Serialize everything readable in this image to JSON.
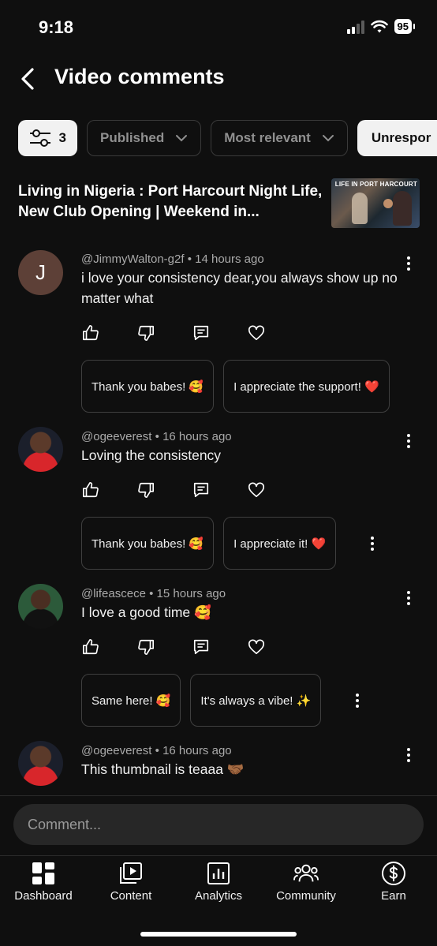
{
  "status": {
    "time": "9:18",
    "battery": "95"
  },
  "header": {
    "title": "Video comments"
  },
  "filters": {
    "filter_count": "3",
    "published": "Published",
    "sort": "Most relevant",
    "unresponded": "Unrespor"
  },
  "video": {
    "title": "Living in Nigeria : Port Harcourt Night Life, New Club Opening | Weekend in...",
    "thumb_text": "LIFE IN PORT HARCOURT"
  },
  "comments": [
    {
      "avatar_letter": "J",
      "author": "@JimmyWalton-g2f",
      "time": "14 hours ago",
      "text": "i love your consistency dear,you always show up no matter what",
      "replies": [
        "Thank you babes! 🥰",
        "I appreciate the support! ❤️"
      ]
    },
    {
      "author": "@ogeeverest",
      "time": "16 hours ago",
      "text": "Loving the consistency",
      "replies": [
        "Thank you babes! 🥰",
        "I appreciate it! ❤️"
      ]
    },
    {
      "author": "@lifeascece",
      "time": "15 hours ago",
      "text": "I love a good time 🥰",
      "replies": [
        "Same here! 🥰",
        "It's always a vibe! ✨"
      ]
    },
    {
      "author": "@ogeeverest",
      "time": "16 hours ago",
      "text": "This thumbnail is teaaa 🤝🏾"
    }
  ],
  "composer": {
    "placeholder": "Comment..."
  },
  "nav": {
    "dashboard": "Dashboard",
    "content": "Content",
    "analytics": "Analytics",
    "community": "Community",
    "earn": "Earn"
  },
  "separator": "•"
}
